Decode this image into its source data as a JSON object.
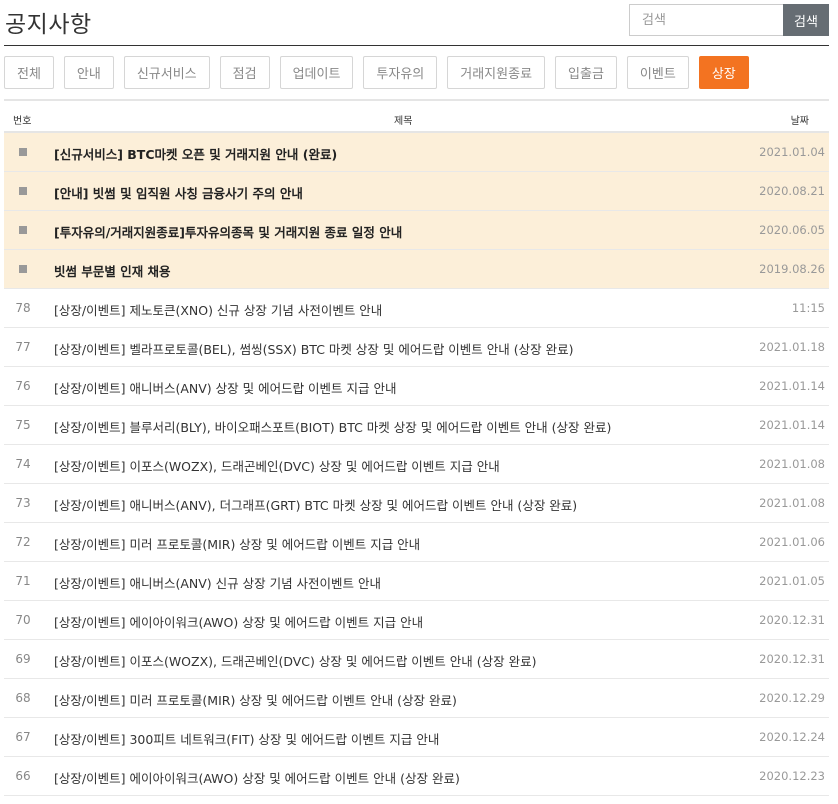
{
  "header": {
    "title": "공지사항",
    "search_placeholder": "검색",
    "search_button": "검색"
  },
  "tabs": [
    {
      "label": "전체",
      "active": false
    },
    {
      "label": "안내",
      "active": false
    },
    {
      "label": "신규서비스",
      "active": false
    },
    {
      "label": "점검",
      "active": false
    },
    {
      "label": "업데이트",
      "active": false
    },
    {
      "label": "투자유의",
      "active": false
    },
    {
      "label": "거래지원종료",
      "active": false
    },
    {
      "label": "입출금",
      "active": false
    },
    {
      "label": "이벤트",
      "active": false
    },
    {
      "label": "상장",
      "active": true
    }
  ],
  "table": {
    "columns": {
      "num": "번호",
      "title": "제목",
      "date": "날짜"
    },
    "notices": [
      {
        "title": "[신규서비스] BTC마켓 오픈 및 거래지원 안내 (완료)",
        "date": "2021.01.04"
      },
      {
        "title": "[안내] 빗썸 및 임직원 사칭 금융사기 주의 안내",
        "date": "2020.08.21"
      },
      {
        "title": "[투자유의/거래지원종료]투자유의종목 및 거래지원 종료 일정 안내",
        "date": "2020.06.05"
      },
      {
        "title": "빗썸 부문별 인재 채용",
        "date": "2019.08.26"
      }
    ],
    "rows": [
      {
        "num": "78",
        "title": "[상장/이벤트] 제노토큰(XNO) 신규 상장 기념 사전이벤트 안내",
        "date": "11:15"
      },
      {
        "num": "77",
        "title": "[상장/이벤트] 벨라프로토콜(BEL), 썸씽(SSX) BTC 마켓 상장 및 에어드랍 이벤트 안내 (상장 완료)",
        "date": "2021.01.18"
      },
      {
        "num": "76",
        "title": "[상장/이벤트] 애니버스(ANV) 상장 및 에어드랍 이벤트 지급 안내",
        "date": "2021.01.14"
      },
      {
        "num": "75",
        "title": "[상장/이벤트] 블루서리(BLY), 바이오패스포트(BIOT) BTC 마켓 상장 및 에어드랍 이벤트 안내 (상장 완료)",
        "date": "2021.01.14"
      },
      {
        "num": "74",
        "title": "[상장/이벤트] 이포스(WOZX), 드래곤베인(DVC) 상장 및 에어드랍 이벤트 지급 안내",
        "date": "2021.01.08"
      },
      {
        "num": "73",
        "title": "[상장/이벤트] 애니버스(ANV), 더그래프(GRT) BTC 마켓 상장 및 에어드랍 이벤트 안내 (상장 완료)",
        "date": "2021.01.08"
      },
      {
        "num": "72",
        "title": "[상장/이벤트] 미러 프로토콜(MIR) 상장 및 에어드랍 이벤트 지급 안내",
        "date": "2021.01.06"
      },
      {
        "num": "71",
        "title": "[상장/이벤트] 애니버스(ANV) 신규 상장 기념 사전이벤트 안내",
        "date": "2021.01.05"
      },
      {
        "num": "70",
        "title": "[상장/이벤트] 에이아이워크(AWO) 상장 및 에어드랍 이벤트 지급 안내",
        "date": "2020.12.31"
      },
      {
        "num": "69",
        "title": "[상장/이벤트] 이포스(WOZX), 드래곤베인(DVC) 상장 및 에어드랍 이벤트 안내 (상장 완료)",
        "date": "2020.12.31"
      },
      {
        "num": "68",
        "title": "[상장/이벤트] 미러 프로토콜(MIR) 상장 및 에어드랍 이벤트 안내 (상장 완료)",
        "date": "2020.12.29"
      },
      {
        "num": "67",
        "title": "[상장/이벤트] 300피트 네트워크(FIT) 상장 및 에어드랍 이벤트 지급 안내",
        "date": "2020.12.24"
      },
      {
        "num": "66",
        "title": "[상장/이벤트] 에이아이워크(AWO) 상장 및 에어드랍 이벤트 안내 (상장 완료)",
        "date": "2020.12.23"
      }
    ]
  },
  "colors": {
    "accent": "#f37321",
    "notice_bg": "#fcefd9",
    "search_button_bg": "#666d73"
  }
}
